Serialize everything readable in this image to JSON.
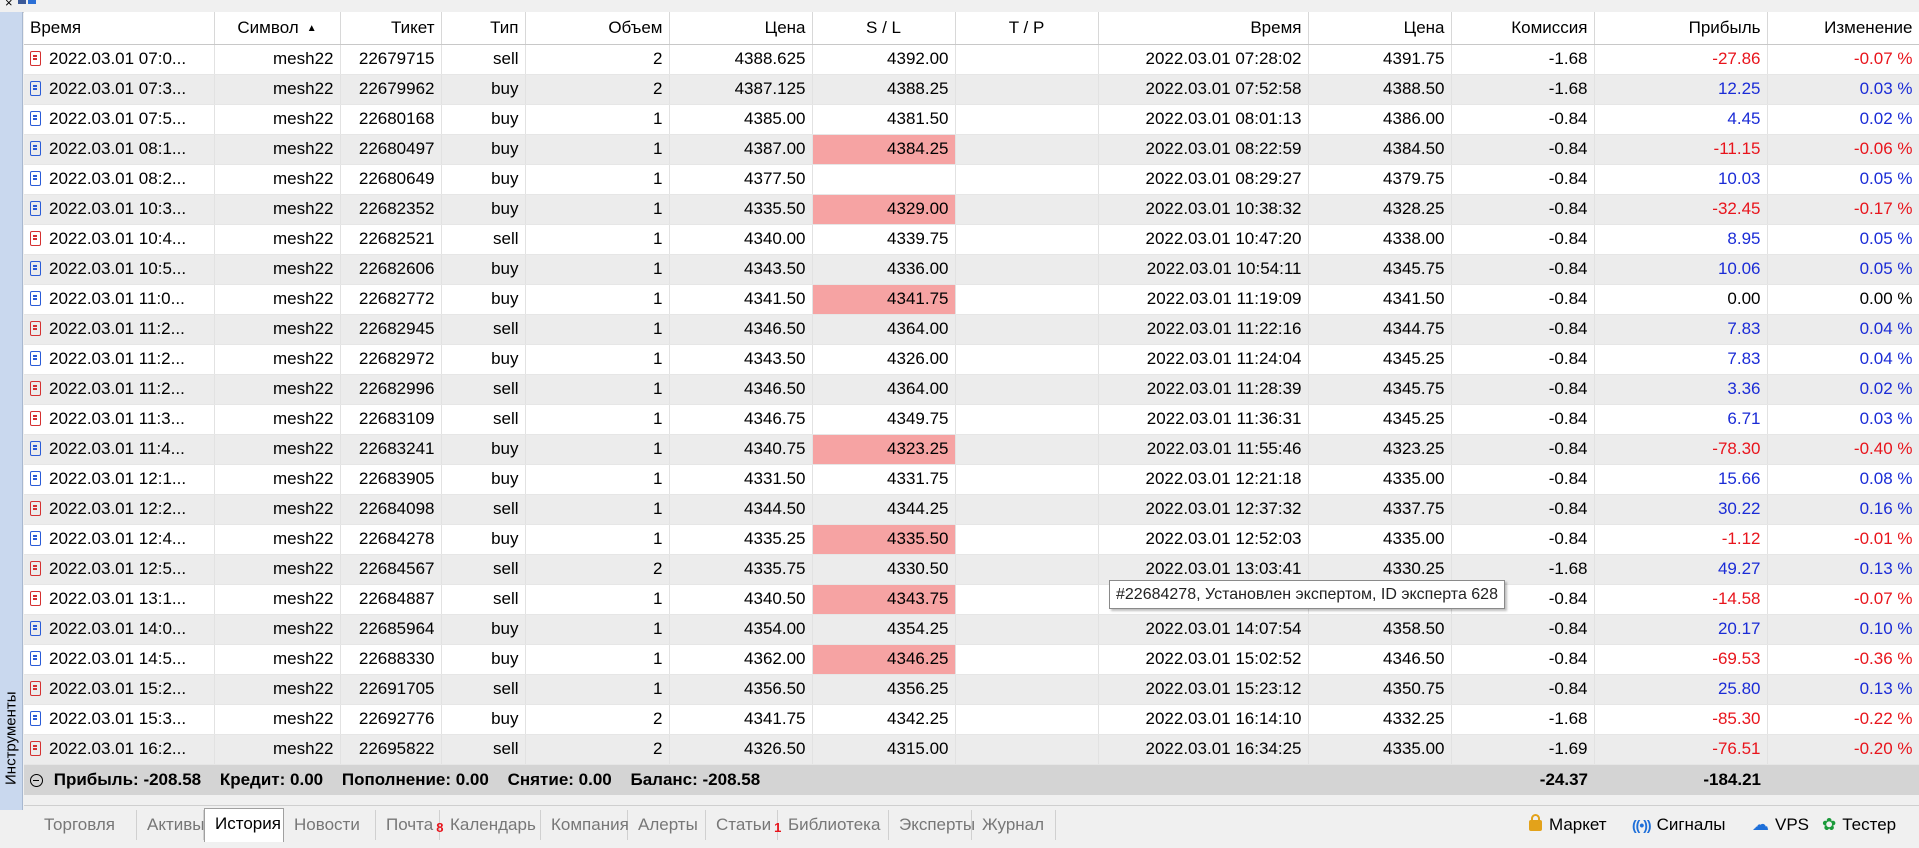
{
  "panel": {
    "sidebar_label": "Инструменты"
  },
  "columns": [
    "Время",
    "Символ",
    "Тикет",
    "Тип",
    "Объем",
    "Цена",
    "S / L",
    "T / P",
    "Время",
    "Цена",
    "Комиссия",
    "Прибыль",
    "Изменение"
  ],
  "rows": [
    {
      "time": "2022.03.01 07:0...",
      "symbol": "mesh22",
      "ticket": "22679715",
      "type": "sell",
      "volume": "2",
      "price": "4388.625",
      "sl": "4392.00",
      "sl_hl": false,
      "tp": "",
      "close_time": "2022.03.01 07:28:02",
      "close_price": "4391.75",
      "commission": "-1.68",
      "profit": "-27.86",
      "change": "-0.07 %"
    },
    {
      "time": "2022.03.01 07:3...",
      "symbol": "mesh22",
      "ticket": "22679962",
      "type": "buy",
      "volume": "2",
      "price": "4387.125",
      "sl": "4388.25",
      "sl_hl": false,
      "tp": "",
      "close_time": "2022.03.01 07:52:58",
      "close_price": "4388.50",
      "commission": "-1.68",
      "profit": "12.25",
      "change": "0.03 %"
    },
    {
      "time": "2022.03.01 07:5...",
      "symbol": "mesh22",
      "ticket": "22680168",
      "type": "buy",
      "volume": "1",
      "price": "4385.00",
      "sl": "4381.50",
      "sl_hl": false,
      "tp": "",
      "close_time": "2022.03.01 08:01:13",
      "close_price": "4386.00",
      "commission": "-0.84",
      "profit": "4.45",
      "change": "0.02 %"
    },
    {
      "time": "2022.03.01 08:1...",
      "symbol": "mesh22",
      "ticket": "22680497",
      "type": "buy",
      "volume": "1",
      "price": "4387.00",
      "sl": "4384.25",
      "sl_hl": true,
      "tp": "",
      "close_time": "2022.03.01 08:22:59",
      "close_price": "4384.50",
      "commission": "-0.84",
      "profit": "-11.15",
      "change": "-0.06 %"
    },
    {
      "time": "2022.03.01 08:2...",
      "symbol": "mesh22",
      "ticket": "22680649",
      "type": "buy",
      "volume": "1",
      "price": "4377.50",
      "sl": "",
      "sl_hl": false,
      "tp": "",
      "close_time": "2022.03.01 08:29:27",
      "close_price": "4379.75",
      "commission": "-0.84",
      "profit": "10.03",
      "change": "0.05 %"
    },
    {
      "time": "2022.03.01 10:3...",
      "symbol": "mesh22",
      "ticket": "22682352",
      "type": "buy",
      "volume": "1",
      "price": "4335.50",
      "sl": "4329.00",
      "sl_hl": true,
      "tp": "",
      "close_time": "2022.03.01 10:38:32",
      "close_price": "4328.25",
      "commission": "-0.84",
      "profit": "-32.45",
      "change": "-0.17 %"
    },
    {
      "time": "2022.03.01 10:4...",
      "symbol": "mesh22",
      "ticket": "22682521",
      "type": "sell",
      "volume": "1",
      "price": "4340.00",
      "sl": "4339.75",
      "sl_hl": false,
      "tp": "",
      "close_time": "2022.03.01 10:47:20",
      "close_price": "4338.00",
      "commission": "-0.84",
      "profit": "8.95",
      "change": "0.05 %"
    },
    {
      "time": "2022.03.01 10:5...",
      "symbol": "mesh22",
      "ticket": "22682606",
      "type": "buy",
      "volume": "1",
      "price": "4343.50",
      "sl": "4336.00",
      "sl_hl": false,
      "tp": "",
      "close_time": "2022.03.01 10:54:11",
      "close_price": "4345.75",
      "commission": "-0.84",
      "profit": "10.06",
      "change": "0.05 %"
    },
    {
      "time": "2022.03.01 11:0...",
      "symbol": "mesh22",
      "ticket": "22682772",
      "type": "buy",
      "volume": "1",
      "price": "4341.50",
      "sl": "4341.75",
      "sl_hl": true,
      "tp": "",
      "close_time": "2022.03.01 11:19:09",
      "close_price": "4341.50",
      "commission": "-0.84",
      "profit": "0.00",
      "change": "0.00 %"
    },
    {
      "time": "2022.03.01 11:2...",
      "symbol": "mesh22",
      "ticket": "22682945",
      "type": "sell",
      "volume": "1",
      "price": "4346.50",
      "sl": "4364.00",
      "sl_hl": false,
      "tp": "",
      "close_time": "2022.03.01 11:22:16",
      "close_price": "4344.75",
      "commission": "-0.84",
      "profit": "7.83",
      "change": "0.04 %"
    },
    {
      "time": "2022.03.01 11:2...",
      "symbol": "mesh22",
      "ticket": "22682972",
      "type": "buy",
      "volume": "1",
      "price": "4343.50",
      "sl": "4326.00",
      "sl_hl": false,
      "tp": "",
      "close_time": "2022.03.01 11:24:04",
      "close_price": "4345.25",
      "commission": "-0.84",
      "profit": "7.83",
      "change": "0.04 %"
    },
    {
      "time": "2022.03.01 11:2...",
      "symbol": "mesh22",
      "ticket": "22682996",
      "type": "sell",
      "volume": "1",
      "price": "4346.50",
      "sl": "4364.00",
      "sl_hl": false,
      "tp": "",
      "close_time": "2022.03.01 11:28:39",
      "close_price": "4345.75",
      "commission": "-0.84",
      "profit": "3.36",
      "change": "0.02 %"
    },
    {
      "time": "2022.03.01 11:3...",
      "symbol": "mesh22",
      "ticket": "22683109",
      "type": "sell",
      "volume": "1",
      "price": "4346.75",
      "sl": "4349.75",
      "sl_hl": false,
      "tp": "",
      "close_time": "2022.03.01 11:36:31",
      "close_price": "4345.25",
      "commission": "-0.84",
      "profit": "6.71",
      "change": "0.03 %"
    },
    {
      "time": "2022.03.01 11:4...",
      "symbol": "mesh22",
      "ticket": "22683241",
      "type": "buy",
      "volume": "1",
      "price": "4340.75",
      "sl": "4323.25",
      "sl_hl": true,
      "tp": "",
      "close_time": "2022.03.01 11:55:46",
      "close_price": "4323.25",
      "commission": "-0.84",
      "profit": "-78.30",
      "change": "-0.40 %"
    },
    {
      "time": "2022.03.01 12:1...",
      "symbol": "mesh22",
      "ticket": "22683905",
      "type": "buy",
      "volume": "1",
      "price": "4331.50",
      "sl": "4331.75",
      "sl_hl": false,
      "tp": "",
      "close_time": "2022.03.01 12:21:18",
      "close_price": "4335.00",
      "commission": "-0.84",
      "profit": "15.66",
      "change": "0.08 %"
    },
    {
      "time": "2022.03.01 12:2...",
      "symbol": "mesh22",
      "ticket": "22684098",
      "type": "sell",
      "volume": "1",
      "price": "4344.50",
      "sl": "4344.25",
      "sl_hl": false,
      "tp": "",
      "close_time": "2022.03.01 12:37:32",
      "close_price": "4337.75",
      "commission": "-0.84",
      "profit": "30.22",
      "change": "0.16 %"
    },
    {
      "time": "2022.03.01 12:4...",
      "symbol": "mesh22",
      "ticket": "22684278",
      "type": "buy",
      "volume": "1",
      "price": "4335.25",
      "sl": "4335.50",
      "sl_hl": true,
      "tp": "",
      "close_time": "2022.03.01 12:52:03",
      "close_price": "4335.00",
      "commission": "-0.84",
      "profit": "-1.12",
      "change": "-0.01 %"
    },
    {
      "time": "2022.03.01 12:5...",
      "symbol": "mesh22",
      "ticket": "22684567",
      "type": "sell",
      "volume": "2",
      "price": "4335.75",
      "sl": "4330.50",
      "sl_hl": false,
      "tp": "",
      "close_time": "2022.03.01 13:03:41",
      "close_price": "4330.25",
      "commission": "-1.68",
      "profit": "49.27",
      "change": "0.13 %"
    },
    {
      "time": "2022.03.01 13:1...",
      "symbol": "mesh22",
      "ticket": "22684887",
      "type": "sell",
      "volume": "1",
      "price": "4340.50",
      "sl": "4343.75",
      "sl_hl": true,
      "tp": "",
      "close_time": "",
      "close_price": "",
      "commission": "-0.84",
      "profit": "-14.58",
      "change": "-0.07 %"
    },
    {
      "time": "2022.03.01 14:0...",
      "symbol": "mesh22",
      "ticket": "22685964",
      "type": "buy",
      "volume": "1",
      "price": "4354.00",
      "sl": "4354.25",
      "sl_hl": false,
      "tp": "",
      "close_time": "2022.03.01 14:07:54",
      "close_price": "4358.50",
      "commission": "-0.84",
      "profit": "20.17",
      "change": "0.10 %"
    },
    {
      "time": "2022.03.01 14:5...",
      "symbol": "mesh22",
      "ticket": "22688330",
      "type": "buy",
      "volume": "1",
      "price": "4362.00",
      "sl": "4346.25",
      "sl_hl": true,
      "tp": "",
      "close_time": "2022.03.01 15:02:52",
      "close_price": "4346.50",
      "commission": "-0.84",
      "profit": "-69.53",
      "change": "-0.36 %"
    },
    {
      "time": "2022.03.01 15:2...",
      "symbol": "mesh22",
      "ticket": "22691705",
      "type": "sell",
      "volume": "1",
      "price": "4356.50",
      "sl": "4356.25",
      "sl_hl": false,
      "tp": "",
      "close_time": "2022.03.01 15:23:12",
      "close_price": "4350.75",
      "commission": "-0.84",
      "profit": "25.80",
      "change": "0.13 %"
    },
    {
      "time": "2022.03.01 15:3...",
      "symbol": "mesh22",
      "ticket": "22692776",
      "type": "buy",
      "volume": "2",
      "price": "4341.75",
      "sl": "4342.25",
      "sl_hl": false,
      "tp": "",
      "close_time": "2022.03.01 16:14:10",
      "close_price": "4332.25",
      "commission": "-1.68",
      "profit": "-85.30",
      "change": "-0.22 %"
    },
    {
      "time": "2022.03.01 16:2...",
      "symbol": "mesh22",
      "ticket": "22695822",
      "type": "sell",
      "volume": "2",
      "price": "4326.50",
      "sl": "4315.00",
      "sl_hl": false,
      "tp": "",
      "close_time": "2022.03.01 16:34:25",
      "close_price": "4335.00",
      "commission": "-1.69",
      "profit": "-76.51",
      "change": "-0.20 %"
    }
  ],
  "summary": {
    "profit": "Прибыль: -208.58",
    "credit": "Кредит: 0.00",
    "deposit": "Пополнение: 0.00",
    "withdrawal": "Снятие: 0.00",
    "balance": "Баланс: -208.58",
    "commission_total": "-24.37",
    "profit_total": "-184.21"
  },
  "tooltip": "#22684278, Установлен экспертом, ID эксперта 628",
  "tabs": [
    {
      "label": "Торговля",
      "badge": "",
      "active": false
    },
    {
      "label": "Активы",
      "badge": "",
      "active": false
    },
    {
      "label": "История",
      "badge": "",
      "active": true
    },
    {
      "label": "Новости",
      "badge": "",
      "active": false
    },
    {
      "label": "Почта",
      "badge": "8",
      "active": false
    },
    {
      "label": "Календарь",
      "badge": "",
      "active": false
    },
    {
      "label": "Компания",
      "badge": "",
      "active": false
    },
    {
      "label": "Алерты",
      "badge": "",
      "active": false
    },
    {
      "label": "Статьи",
      "badge": "1",
      "active": false
    },
    {
      "label": "Библиотека",
      "badge": "",
      "active": false
    },
    {
      "label": "Эксперты",
      "badge": "",
      "active": false
    },
    {
      "label": "Журнал",
      "badge": "",
      "active": false
    }
  ],
  "right_tabs": [
    {
      "label": "Маркет",
      "icon": "market-lock-icon"
    },
    {
      "label": "Сигналы",
      "icon": "signals-icon"
    },
    {
      "label": "VPS",
      "icon": "vps-cloud-icon"
    },
    {
      "label": "Тестер",
      "icon": "tester-icon"
    }
  ],
  "colors": {
    "positive": "#1a2bd6",
    "negative": "#e8141c",
    "sl_highlight": "#f6a3a3",
    "row_alt": "#ececec",
    "summary_bg": "#d4d4d4"
  }
}
